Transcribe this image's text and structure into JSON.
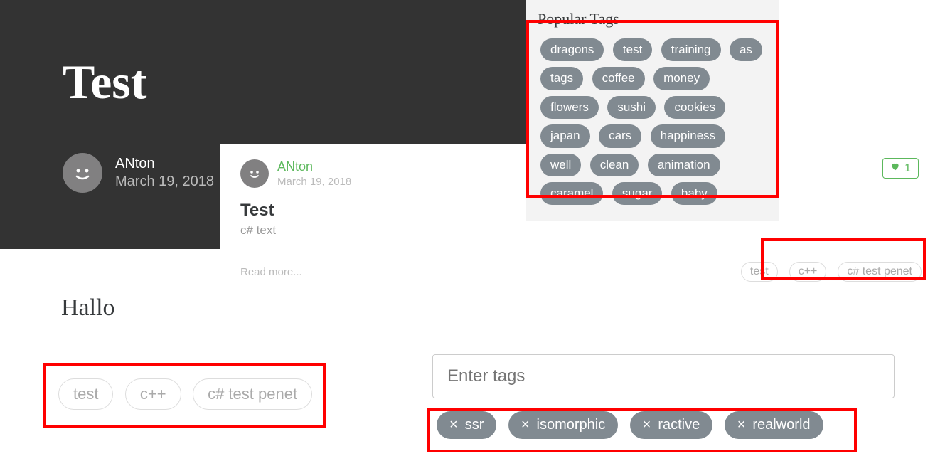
{
  "banner": {
    "title": "Test",
    "author": "ANton",
    "date": "March 19, 2018"
  },
  "feed": {
    "author": "ANton",
    "date": "March 19, 2018",
    "title": "Test",
    "description": "c# text",
    "read_more": "Read more...",
    "like_count": "1",
    "tags": [
      "test",
      "c++",
      "c# test penet"
    ]
  },
  "popular": {
    "heading": "Popular Tags",
    "tags": [
      "dragons",
      "test",
      "training",
      "as",
      "tags",
      "coffee",
      "money",
      "flowers",
      "sushi",
      "cookies",
      "japan",
      "cars",
      "happiness",
      "well",
      "clean",
      "animation",
      "caramel",
      "sugar",
      "baby"
    ]
  },
  "body": {
    "text": "Hallo",
    "outline_tags": [
      "test",
      "c++",
      "c# test penet"
    ]
  },
  "editor": {
    "placeholder": "Enter tags",
    "chosen": [
      "ssr",
      "isomorphic",
      "ractive",
      "realworld"
    ]
  }
}
